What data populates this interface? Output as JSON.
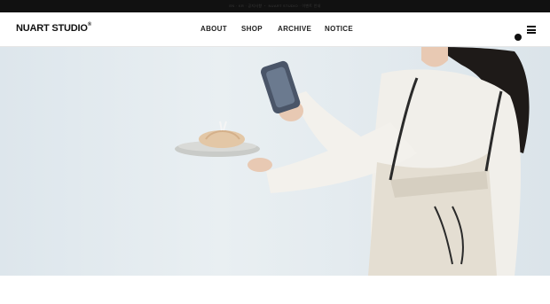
{
  "topbar": {
    "text": "EN ‧ KR ‧ 공지사항 ‧ NUART STUDIO ‧ 이벤트 안내"
  },
  "header": {
    "logo": "NUART STUDIO",
    "logo_mark": "®",
    "nav": [
      "ABOUT",
      "SHOP",
      "ARCHIVE",
      "NOTICE"
    ]
  },
  "icons": {
    "menu": "hamburger-menu-icon",
    "indicator": "dot-indicator"
  },
  "colors": {
    "topbar": "#111111",
    "hero_bg": "#dfe7ec",
    "apron": "#e6e1d6",
    "sweater": "#f3f1ec"
  }
}
